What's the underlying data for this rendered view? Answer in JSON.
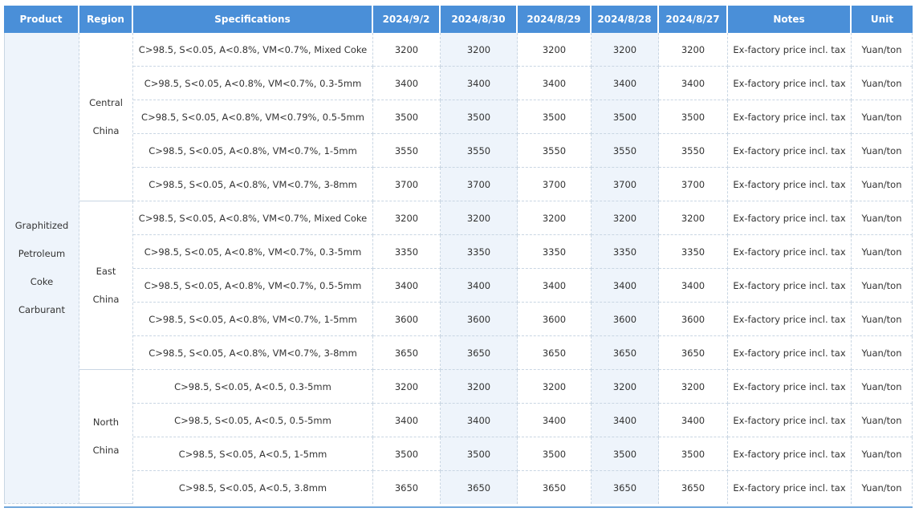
{
  "headers": [
    "Product",
    "Region",
    "Specifications",
    "2024/9/2",
    "2024/8/30",
    "2024/8/29",
    "2024/8/28",
    "2024/8/27",
    "Notes",
    "Unit"
  ],
  "product_lines": [
    "Graphitized",
    "Petroleum",
    "Coke",
    "Carburant"
  ],
  "regions": [
    {
      "name_lines": [
        "Central",
        "China"
      ],
      "rows": [
        {
          "spec": "C>98.5, S<0.05, A<0.8%, VM<0.7%, Mixed Coke",
          "prices": [
            "3200",
            "3200",
            "3200",
            "3200",
            "3200"
          ],
          "note": "Ex-factory price incl. tax",
          "unit": "Yuan/ton"
        },
        {
          "spec": "C>98.5, S<0.05, A<0.8%, VM<0.7%, 0.3-5mm",
          "prices": [
            "3400",
            "3400",
            "3400",
            "3400",
            "3400"
          ],
          "note": "Ex-factory price incl. tax",
          "unit": "Yuan/ton"
        },
        {
          "spec": "C>98.5, S<0.05, A<0.8%, VM<0.79%, 0.5-5mm",
          "prices": [
            "3500",
            "3500",
            "3500",
            "3500",
            "3500"
          ],
          "note": "Ex-factory price incl. tax",
          "unit": "Yuan/ton"
        },
        {
          "spec": "C>98.5, S<0.05, A<0.8%, VM<0.7%, 1-5mm",
          "prices": [
            "3550",
            "3550",
            "3550",
            "3550",
            "3550"
          ],
          "note": "Ex-factory price incl. tax",
          "unit": "Yuan/ton"
        },
        {
          "spec": "C>98.5, S<0.05, A<0.8%, VM<0.7%, 3-8mm",
          "prices": [
            "3700",
            "3700",
            "3700",
            "3700",
            "3700"
          ],
          "note": "Ex-factory price incl. tax",
          "unit": "Yuan/ton"
        }
      ]
    },
    {
      "name_lines": [
        "East",
        "China"
      ],
      "rows": [
        {
          "spec": "C>98.5, S<0.05, A<0.8%, VM<0.7%, Mixed Coke",
          "prices": [
            "3200",
            "3200",
            "3200",
            "3200",
            "3200"
          ],
          "note": "Ex-factory price incl. tax",
          "unit": "Yuan/ton"
        },
        {
          "spec": "C>98.5, S<0.05, A<0.8%, VM<0.7%, 0.3-5mm",
          "prices": [
            "3350",
            "3350",
            "3350",
            "3350",
            "3350"
          ],
          "note": "Ex-factory price incl. tax",
          "unit": "Yuan/ton"
        },
        {
          "spec": "C>98.5, S<0.05, A<0.8%, VM<0.7%, 0.5-5mm",
          "prices": [
            "3400",
            "3400",
            "3400",
            "3400",
            "3400"
          ],
          "note": "Ex-factory price incl. tax",
          "unit": "Yuan/ton"
        },
        {
          "spec": "C>98.5, S<0.05, A<0.8%, VM<0.7%, 1-5mm",
          "prices": [
            "3600",
            "3600",
            "3600",
            "3600",
            "3600"
          ],
          "note": "Ex-factory price incl. tax",
          "unit": "Yuan/ton"
        },
        {
          "spec": "C>98.5, S<0.05, A<0.8%, VM<0.7%, 3-8mm",
          "prices": [
            "3650",
            "3650",
            "3650",
            "3650",
            "3650"
          ],
          "note": "Ex-factory price incl. tax",
          "unit": "Yuan/ton"
        }
      ]
    },
    {
      "name_lines": [
        "North",
        "China"
      ],
      "rows": [
        {
          "spec": "C>98.5, S<0.05, A<0.5, 0.3-5mm",
          "prices": [
            "3200",
            "3200",
            "3200",
            "3200",
            "3200"
          ],
          "note": "Ex-factory price incl. tax",
          "unit": "Yuan/ton"
        },
        {
          "spec": "C>98.5, S<0.05, A<0.5, 0.5-5mm",
          "prices": [
            "3400",
            "3400",
            "3400",
            "3400",
            "3400"
          ],
          "note": "Ex-factory price incl. tax",
          "unit": "Yuan/ton"
        },
        {
          "spec": "C>98.5, S<0.05, A<0.5, 1-5mm",
          "prices": [
            "3500",
            "3500",
            "3500",
            "3500",
            "3500"
          ],
          "note": "Ex-factory price incl. tax",
          "unit": "Yuan/ton"
        },
        {
          "spec": "C>98.5, S<0.05, A<0.5, 3.8mm",
          "prices": [
            "3650",
            "3650",
            "3650",
            "3650",
            "3650"
          ],
          "note": "Ex-factory price incl. tax",
          "unit": "Yuan/ton"
        }
      ]
    }
  ],
  "colors": {
    "header_bg": "#4a8fd8",
    "header_text": "#ffffff",
    "shade": "#eef4fb",
    "grid": "#c9d6e3"
  }
}
